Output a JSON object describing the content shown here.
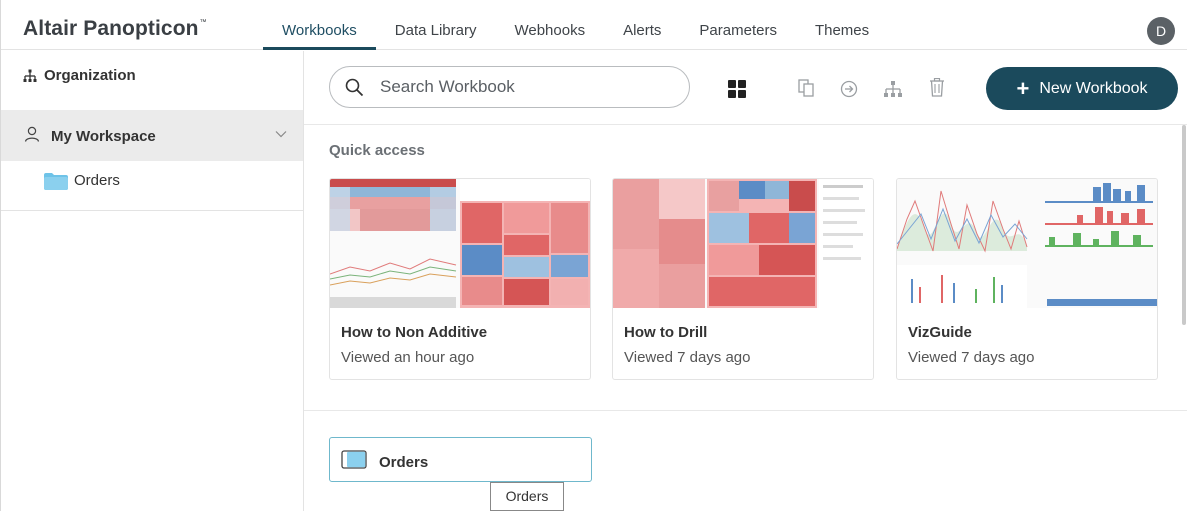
{
  "header": {
    "brand": "Altair Panopticon",
    "trademark": "™",
    "nav": [
      {
        "label": "Workbooks",
        "active": true
      },
      {
        "label": "Data Library",
        "active": false
      },
      {
        "label": "Webhooks",
        "active": false
      },
      {
        "label": "Alerts",
        "active": false
      },
      {
        "label": "Parameters",
        "active": false
      },
      {
        "label": "Themes",
        "active": false
      }
    ],
    "avatar_initial": "D"
  },
  "sidebar": {
    "organization_label": "Organization",
    "workspace_label": "My Workspace",
    "folder_label": "Orders",
    "icons": {
      "organization": "org-chart-icon",
      "workspace": "user-icon",
      "expand": "chevron-down-icon",
      "folder": "folder-icon"
    }
  },
  "toolbar": {
    "search_placeholder": "Search Workbook",
    "icons": [
      "grid-view-icon",
      "copy-icon",
      "move-icon",
      "org-chart-icon",
      "trash-icon"
    ],
    "new_button_label": "New Workbook"
  },
  "quick_access": {
    "title": "Quick access",
    "cards": [
      {
        "title": "How to Non Additive",
        "subtitle": "Viewed an hour ago"
      },
      {
        "title": "How to Drill",
        "subtitle": "Viewed 7 days ago"
      },
      {
        "title": "VizGuide",
        "subtitle": "Viewed 7 days ago"
      }
    ]
  },
  "folders": [
    {
      "label": "Orders",
      "tooltip": "Orders"
    }
  ],
  "colors": {
    "accent": "#1b4a5c",
    "folder": "#6ec3e8",
    "focus_border": "#6fb8cc"
  }
}
